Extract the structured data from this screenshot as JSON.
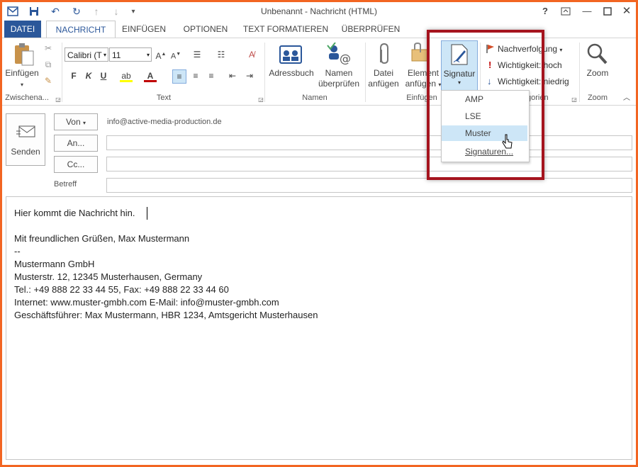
{
  "window": {
    "title": "Unbenannt - Nachricht (HTML)",
    "help": "?",
    "accent": "#2b579a",
    "frame_color": "#f26522",
    "highlight_color": "#a5141e"
  },
  "tabs": [
    {
      "label": "DATEI"
    },
    {
      "label": "NACHRICHT"
    },
    {
      "label": "EINFÜGEN"
    },
    {
      "label": "OPTIONEN"
    },
    {
      "label": "TEXT FORMATIEREN"
    },
    {
      "label": "ÜBERPRÜFEN"
    }
  ],
  "ribbon": {
    "clipboard": {
      "paste_label": "Einfügen",
      "group_label": "Zwischena..."
    },
    "text": {
      "font_name": "Calibri (T",
      "font_size": "11",
      "group_label": "Text",
      "bold": "F",
      "italic": "K",
      "underline": "U"
    },
    "names": {
      "addressbook_label": "Adressbuch",
      "check_names_line1": "Namen",
      "check_names_line2": "überprüfen",
      "group_label": "Namen"
    },
    "include": {
      "attach_file_line1": "Datei",
      "attach_file_line2": "anfügen",
      "attach_item_line1": "Element",
      "attach_item_line2": "anfügen",
      "signature_label": "Signatur",
      "group_label": "Einfügen"
    },
    "tags": {
      "followup_label": "Nachverfolgung",
      "high_importance_label": "Wichtigkeit: hoch",
      "low_importance_label": "Wichtigkeit: niedrig",
      "group_label": "Kategorien"
    },
    "zoom": {
      "zoom_label": "Zoom",
      "group_label": "Zoom"
    }
  },
  "signature_menu": {
    "items": [
      {
        "label": "AMP"
      },
      {
        "label": "LSE"
      },
      {
        "label": "Muster"
      },
      {
        "label": "Signaturen..."
      }
    ],
    "highlighted": "Muster"
  },
  "compose": {
    "send_label": "Senden",
    "from_button": "Von",
    "from_value": "info@active-media-production.de",
    "to_button": "An...",
    "cc_button": "Cc...",
    "subject_label": "Betreff",
    "to_value": "",
    "cc_value": "",
    "subject_value": ""
  },
  "message_body": {
    "lines": [
      "Hier kommt die Nachricht hin.",
      "",
      "Mit freundlichen Grüßen, Max Mustermann",
      "--",
      "Mustermann GmbH",
      "Musterstr. 12, 12345 Musterhausen, Germany",
      "Tel.: +49 888 22 33 44 55, Fax: +49 888 22 33 44 60",
      "Internet: www.muster-gmbh.com E-Mail: info@muster-gmbh.com",
      "Geschäftsführer: Max Mustermann, HBR 1234, Amtsgericht Musterhausen"
    ]
  }
}
